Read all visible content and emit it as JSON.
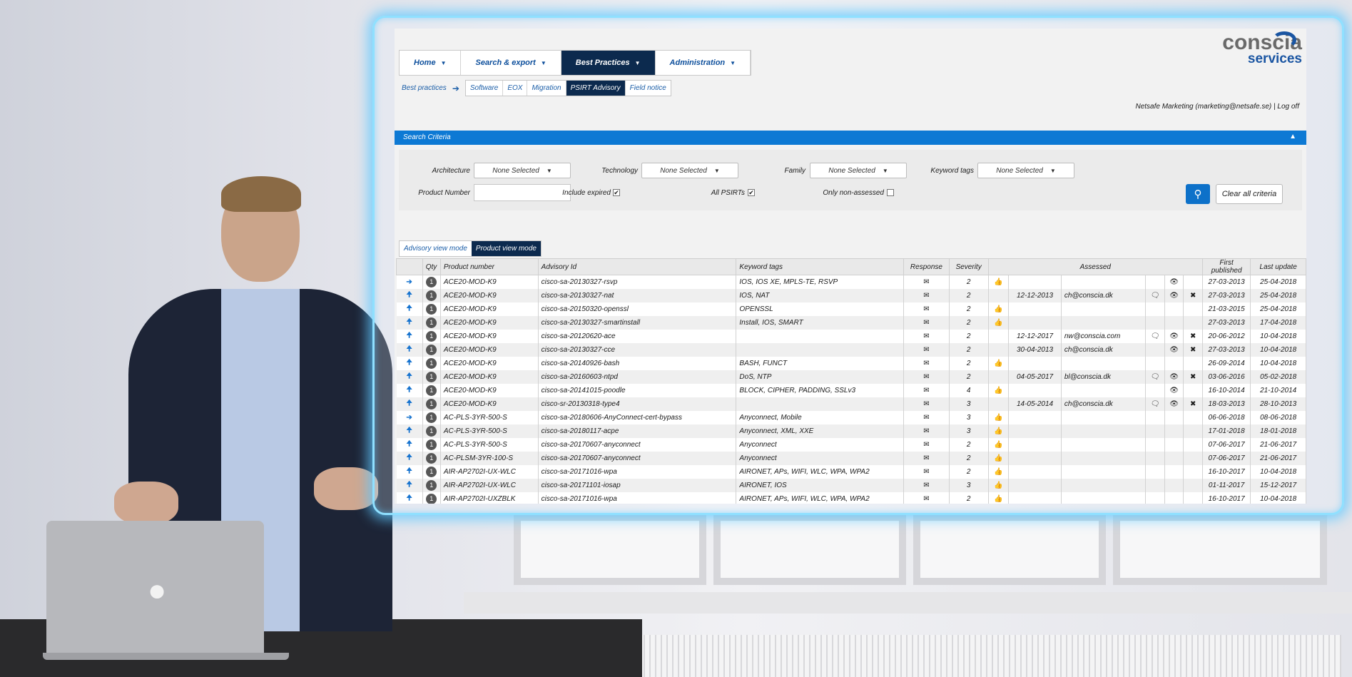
{
  "nav": {
    "tabs": [
      {
        "label": "Home",
        "active": false
      },
      {
        "label": "Search & export",
        "active": false
      },
      {
        "label": "Best Practices",
        "active": true
      },
      {
        "label": "Administration",
        "active": false
      }
    ]
  },
  "subnav": {
    "crumb": "Best practices",
    "items": [
      {
        "label": "Software",
        "active": false
      },
      {
        "label": "EOX",
        "active": false
      },
      {
        "label": "Migration",
        "active": false
      },
      {
        "label": "PSIRT Advisory",
        "active": true
      },
      {
        "label": "Field notice",
        "active": false
      }
    ]
  },
  "logo": {
    "name": "conscia",
    "tagline": "services"
  },
  "user": {
    "text": "Netsafe Marketing (marketing@netsafe.se) | Log off"
  },
  "criteria": {
    "title": "Search Criteria",
    "architecture_label": "Architecture",
    "architecture_value": "None Selected",
    "technology_label": "Technology",
    "technology_value": "None Selected",
    "family_label": "Family",
    "family_value": "None Selected",
    "keyword_label": "Keyword tags",
    "keyword_value": "None Selected",
    "product_number_label": "Product Number",
    "include_expired_label": "Include expired",
    "include_expired_checked": true,
    "all_psirts_label": "All PSIRTs",
    "all_psirts_checked": true,
    "only_non_assessed_label": "Only non-assessed",
    "only_non_assessed_checked": false,
    "clear_label": "Clear all criteria"
  },
  "view_modes": [
    {
      "label": "Advisory view mode",
      "active": false
    },
    {
      "label": "Product view mode",
      "active": true
    }
  ],
  "table": {
    "headers": {
      "qty": "Qty",
      "product": "Product number",
      "advisory": "Advisory Id",
      "keywords": "Keyword tags",
      "response": "Response",
      "severity": "Severity",
      "assessed": "Assessed",
      "first": "First published",
      "last": "Last update"
    },
    "rows": [
      {
        "arrow": "right",
        "qty": "1",
        "product": "ACE20-MOD-K9",
        "advisory": "cisco-sa-20130327-rsvp",
        "keywords": "IOS, IOS XE, MPLS-TE, RSVP",
        "severity": "2",
        "thumb": true,
        "date": "",
        "email": "",
        "comment": false,
        "eye": true,
        "x": false,
        "first": "27-03-2013",
        "last": "25-04-2018"
      },
      {
        "arrow": "up",
        "qty": "1",
        "product": "ACE20-MOD-K9",
        "advisory": "cisco-sa-20130327-nat",
        "keywords": "IOS, NAT",
        "severity": "2",
        "thumb": false,
        "date": "12-12-2013",
        "email": "ch@conscia.dk",
        "comment": true,
        "eye": true,
        "x": true,
        "first": "27-03-2013",
        "last": "25-04-2018"
      },
      {
        "arrow": "up",
        "qty": "1",
        "product": "ACE20-MOD-K9",
        "advisory": "cisco-sa-20150320-openssl",
        "keywords": "OPENSSL",
        "severity": "2",
        "thumb": true,
        "date": "",
        "email": "",
        "comment": false,
        "eye": false,
        "x": false,
        "first": "21-03-2015",
        "last": "25-04-2018"
      },
      {
        "arrow": "up",
        "qty": "1",
        "product": "ACE20-MOD-K9",
        "advisory": "cisco-sa-20130327-smartinstall",
        "keywords": "Install, IOS, SMART",
        "severity": "2",
        "thumb": true,
        "date": "",
        "email": "",
        "comment": false,
        "eye": false,
        "x": false,
        "first": "27-03-2013",
        "last": "17-04-2018"
      },
      {
        "arrow": "up",
        "qty": "1",
        "product": "ACE20-MOD-K9",
        "advisory": "cisco-sa-20120620-ace",
        "keywords": "",
        "severity": "2",
        "thumb": false,
        "date": "12-12-2017",
        "email": "nw@conscia.com",
        "comment": true,
        "eye": true,
        "x": true,
        "first": "20-06-2012",
        "last": "10-04-2018"
      },
      {
        "arrow": "up",
        "qty": "1",
        "product": "ACE20-MOD-K9",
        "advisory": "cisco-sa-20130327-cce",
        "keywords": "",
        "severity": "2",
        "thumb": false,
        "date": "30-04-2013",
        "email": "ch@conscia.dk",
        "comment": false,
        "eye": true,
        "x": true,
        "first": "27-03-2013",
        "last": "10-04-2018"
      },
      {
        "arrow": "up",
        "qty": "1",
        "product": "ACE20-MOD-K9",
        "advisory": "cisco-sa-20140926-bash",
        "keywords": "BASH, FUNCT",
        "severity": "2",
        "thumb": true,
        "date": "",
        "email": "",
        "comment": false,
        "eye": false,
        "x": false,
        "first": "26-09-2014",
        "last": "10-04-2018"
      },
      {
        "arrow": "up",
        "qty": "1",
        "product": "ACE20-MOD-K9",
        "advisory": "cisco-sa-20160603-ntpd",
        "keywords": "DoS, NTP",
        "severity": "2",
        "thumb": false,
        "date": "04-05-2017",
        "email": "bl@conscia.dk",
        "comment": true,
        "eye": true,
        "x": true,
        "first": "03-06-2016",
        "last": "05-02-2018"
      },
      {
        "arrow": "up",
        "qty": "1",
        "product": "ACE20-MOD-K9",
        "advisory": "cisco-sa-20141015-poodle",
        "keywords": "BLOCK, CIPHER, PADDING, SSLv3",
        "severity": "4",
        "thumb": true,
        "date": "",
        "email": "",
        "comment": false,
        "eye": true,
        "x": false,
        "first": "16-10-2014",
        "last": "21-10-2014"
      },
      {
        "arrow": "up",
        "qty": "1",
        "product": "ACE20-MOD-K9",
        "advisory": "cisco-sr-20130318-type4",
        "keywords": "",
        "severity": "3",
        "thumb": false,
        "date": "14-05-2014",
        "email": "ch@conscia.dk",
        "comment": true,
        "eye": true,
        "x": true,
        "first": "18-03-2013",
        "last": "28-10-2013"
      },
      {
        "arrow": "right",
        "qty": "1",
        "product": "AC-PLS-3YR-500-S",
        "advisory": "cisco-sa-20180606-AnyConnect-cert-bypass",
        "keywords": "Anyconnect, Mobile",
        "severity": "3",
        "thumb": true,
        "date": "",
        "email": "",
        "comment": false,
        "eye": false,
        "x": false,
        "first": "06-06-2018",
        "last": "08-06-2018"
      },
      {
        "arrow": "up",
        "qty": "1",
        "product": "AC-PLS-3YR-500-S",
        "advisory": "cisco-sa-20180117-acpe",
        "keywords": "Anyconnect, XML, XXE",
        "severity": "3",
        "thumb": true,
        "date": "",
        "email": "",
        "comment": false,
        "eye": false,
        "x": false,
        "first": "17-01-2018",
        "last": "18-01-2018"
      },
      {
        "arrow": "up",
        "qty": "1",
        "product": "AC-PLS-3YR-500-S",
        "advisory": "cisco-sa-20170607-anyconnect",
        "keywords": "Anyconnect",
        "severity": "2",
        "thumb": true,
        "date": "",
        "email": "",
        "comment": false,
        "eye": false,
        "x": false,
        "first": "07-06-2017",
        "last": "21-06-2017"
      },
      {
        "arrow": "up",
        "qty": "1",
        "product": "AC-PLSM-3YR-100-S",
        "advisory": "cisco-sa-20170607-anyconnect",
        "keywords": "Anyconnect",
        "severity": "2",
        "thumb": true,
        "date": "",
        "email": "",
        "comment": false,
        "eye": false,
        "x": false,
        "first": "07-06-2017",
        "last": "21-06-2017"
      },
      {
        "arrow": "up",
        "qty": "1",
        "product": "AIR-AP2702I-UX-WLC",
        "advisory": "cisco-sa-20171016-wpa",
        "keywords": "AIRONET, APs, WIFI, WLC, WPA, WPA2",
        "severity": "2",
        "thumb": true,
        "date": "",
        "email": "",
        "comment": false,
        "eye": false,
        "x": false,
        "first": "16-10-2017",
        "last": "10-04-2018"
      },
      {
        "arrow": "up",
        "qty": "1",
        "product": "AIR-AP2702I-UX-WLC",
        "advisory": "cisco-sa-20171101-iosap",
        "keywords": "AIRONET, IOS",
        "severity": "3",
        "thumb": true,
        "date": "",
        "email": "",
        "comment": false,
        "eye": false,
        "x": false,
        "first": "01-11-2017",
        "last": "15-12-2017"
      },
      {
        "arrow": "up",
        "qty": "1",
        "product": "AIR-AP2702I-UXZBLK",
        "advisory": "cisco-sa-20171016-wpa",
        "keywords": "AIRONET, APs, WIFI, WLC, WPA, WPA2",
        "severity": "2",
        "thumb": true,
        "date": "",
        "email": "",
        "comment": false,
        "eye": false,
        "x": false,
        "first": "16-10-2017",
        "last": "10-04-2018"
      }
    ]
  }
}
